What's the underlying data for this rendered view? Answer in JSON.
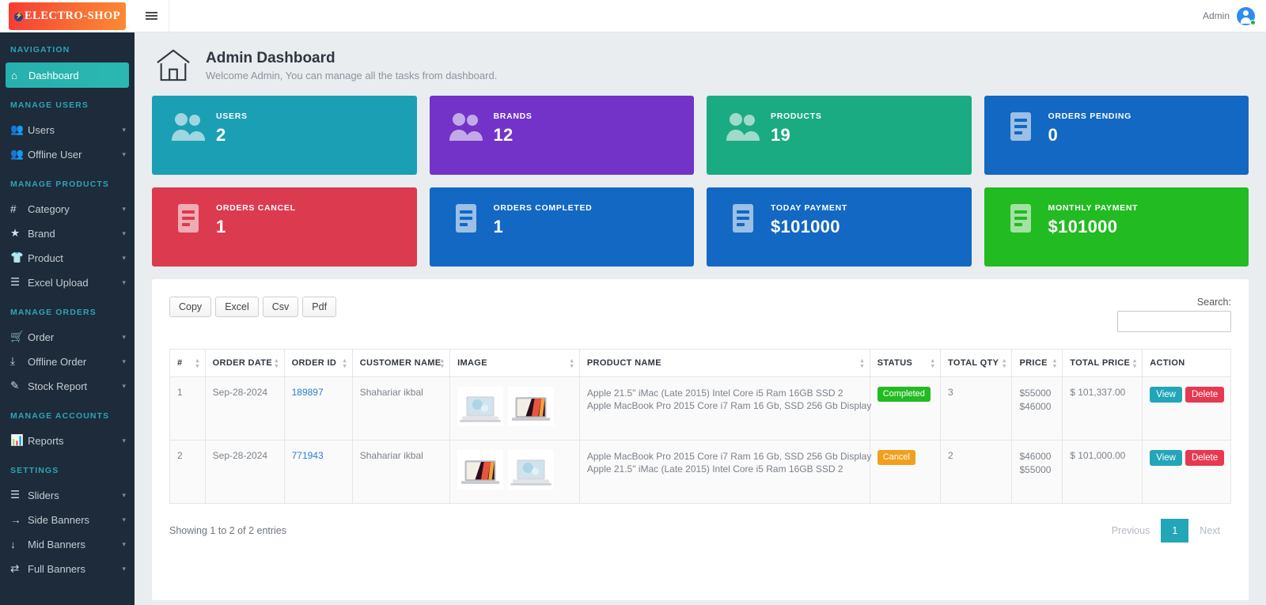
{
  "brand": {
    "name": "ELECTRO-SHOP",
    "icon": "bolt-icon"
  },
  "topbar": {
    "admin_label": "Admin",
    "menu_icon": "hamburger-icon",
    "avatar_icon": "user-avatar-icon"
  },
  "page": {
    "icon": "home-icon",
    "title": "Admin Dashboard",
    "subtitle": "Welcome Admin, You can manage all the tasks from dashboard."
  },
  "sidebar": {
    "sections": [
      {
        "label": "NAVIGATION",
        "items": [
          {
            "label": "Dashboard",
            "icon": "home-icon",
            "active": true,
            "caret": false
          }
        ]
      },
      {
        "label": "MANAGE USERS",
        "items": [
          {
            "label": "Users",
            "icon": "users-icon",
            "active": false,
            "caret": true
          },
          {
            "label": "Offline User",
            "icon": "users-icon",
            "active": false,
            "caret": true
          }
        ]
      },
      {
        "label": "MANAGE PRODUCTS",
        "items": [
          {
            "label": "Category",
            "icon": "hash-icon",
            "active": false,
            "caret": true
          },
          {
            "label": "Brand",
            "icon": "star-icon",
            "active": false,
            "caret": true
          },
          {
            "label": "Product",
            "icon": "tshirt-icon",
            "active": false,
            "caret": true
          },
          {
            "label": "Excel Upload",
            "icon": "list-icon",
            "active": false,
            "caret": true
          }
        ]
      },
      {
        "label": "MANAGE ORDERS",
        "items": [
          {
            "label": "Order",
            "icon": "cart-icon",
            "active": false,
            "caret": true
          },
          {
            "label": "Offline Order",
            "icon": "inbox-download-icon",
            "active": false,
            "caret": true
          },
          {
            "label": "Stock Report",
            "icon": "edit-square-icon",
            "active": false,
            "caret": true
          }
        ]
      },
      {
        "label": "MANAGE ACCOUNTS",
        "items": [
          {
            "label": "Reports",
            "icon": "bar-chart-icon",
            "active": false,
            "caret": true
          }
        ]
      },
      {
        "label": "SETTINGS",
        "items": [
          {
            "label": "Sliders",
            "icon": "stack-lines-icon",
            "active": false,
            "caret": true
          },
          {
            "label": "Side Banners",
            "icon": "arrow-right-icon",
            "active": false,
            "caret": true
          },
          {
            "label": "Mid Banners",
            "icon": "arrow-down-icon",
            "active": false,
            "caret": true
          },
          {
            "label": "Full Banners",
            "icon": "exchange-arrows-icon",
            "active": false,
            "caret": true
          }
        ]
      }
    ]
  },
  "cards": [
    {
      "title": "USERS",
      "value": "2",
      "color": "#1b9fb5",
      "icon": "users-icon"
    },
    {
      "title": "BRANDS",
      "value": "12",
      "color": "#7333c8",
      "icon": "users-icon"
    },
    {
      "title": "PRODUCTS",
      "value": "19",
      "color": "#1bab83",
      "icon": "users-icon"
    },
    {
      "title": "ORDERS PENDING",
      "value": "0",
      "color": "#1268c3",
      "icon": "document-icon"
    },
    {
      "title": "ORDERS CANCEL",
      "value": "1",
      "color": "#dc3a4f",
      "icon": "document-icon"
    },
    {
      "title": "ORDERS COMPLETED",
      "value": "1",
      "color": "#1268c3",
      "icon": "document-icon"
    },
    {
      "title": "TODAY PAYMENT",
      "value": "$101000",
      "color": "#1268c3",
      "icon": "document-icon"
    },
    {
      "title": "MONTHLY PAYMENT",
      "value": "$101000",
      "color": "#22bb22",
      "icon": "document-icon"
    }
  ],
  "table_tools": {
    "buttons": [
      "Copy",
      "Excel",
      "Csv",
      "Pdf"
    ],
    "search_label": "Search:",
    "search_value": "",
    "search_placeholder": ""
  },
  "table": {
    "columns": [
      "#",
      "ORDER DATE",
      "ORDER ID",
      "CUSTOMER NAME",
      "IMAGE",
      "PRODUCT NAME",
      "STATUS",
      "TOTAL QTY",
      "PRICE",
      "TOTAL PRICE",
      "ACTION"
    ],
    "rows": [
      {
        "num": "1",
        "order_date": "Sep-28-2024",
        "order_id": "189897",
        "customer": "Shahariar ikbal",
        "images": [
          "laptop-silver-thumb",
          "macbook-pro-thumb"
        ],
        "products": [
          "Apple 21.5\" iMac (Late 2015) Intel Core i5 Ram 16GB SSD 2",
          "Apple MacBook Pro 2015 Core i7 Ram 16 Gb, SSD 256 Gb Display"
        ],
        "status": "Completed",
        "status_color": "#22bb22",
        "qty": "3",
        "prices": [
          "$55000",
          "$46000"
        ],
        "total_price": "$ 101,337.00",
        "actions": [
          "View",
          "Delete"
        ]
      },
      {
        "num": "2",
        "order_date": "Sep-28-2024",
        "order_id": "771943",
        "customer": "Shahariar ikbal",
        "images": [
          "macbook-pro-thumb",
          "laptop-silver-thumb"
        ],
        "products": [
          "Apple MacBook Pro 2015 Core i7 Ram 16 Gb, SSD 256 Gb Display",
          "Apple 21.5\" iMac (Late 2015) Intel Core i5 Ram 16GB SSD 2"
        ],
        "status": "Cancel",
        "status_color": "#f0a01e",
        "qty": "2",
        "prices": [
          "$46000",
          "$55000"
        ],
        "total_price": "$ 101,000.00",
        "actions": [
          "View",
          "Delete"
        ]
      }
    ]
  },
  "footer": {
    "entries": "Showing 1 to 2 of 2 entries",
    "pagination": [
      "Previous",
      "1",
      "Next"
    ],
    "current_page": "1"
  }
}
